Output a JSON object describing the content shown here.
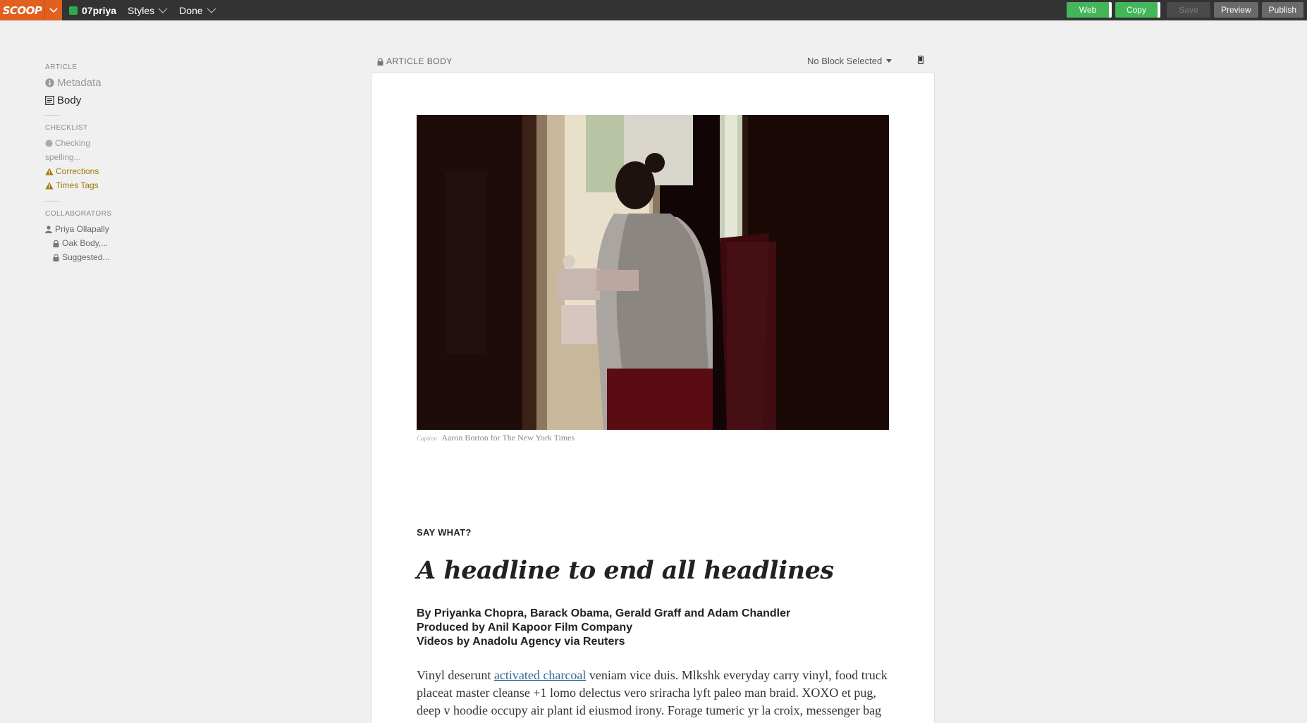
{
  "topbar": {
    "logo": "SCOOP",
    "user": "07priya",
    "menus": [
      "Styles",
      "Done"
    ],
    "buttons": {
      "web": "Web",
      "copy": "Copy",
      "save": "Save",
      "preview": "Preview",
      "publish": "Publish"
    },
    "colors": {
      "brand": "#e0601e",
      "green": "#43b65a",
      "bar": "#333333"
    }
  },
  "sidebar": {
    "article_title": "ARTICLE",
    "metadata": "Metadata",
    "body": "Body",
    "checklist_title": "CHECKLIST",
    "checking_1": "Checking",
    "checking_2": "spelling...",
    "corrections": "Corrections",
    "times_tags": "Times Tags",
    "collaborators_title": "COLLABORATORS",
    "collaborator": "Priya Ollapally",
    "lock_1": "Oak Body,...",
    "lock_2": "Suggested..."
  },
  "editor": {
    "label": "ARTICLE BODY",
    "block_selector": "No Block Selected"
  },
  "article": {
    "caption_tag": "Caption",
    "caption": "Aaron Borton for The New York Times",
    "kicker": "SAY WHAT?",
    "headline": "A headline to end all headlines",
    "byline_1": "By Priyanka Chopra, Barack Obama, Gerald Graff and Adam Chandler",
    "byline_2": "Produced by Anil Kapoor Film Company",
    "byline_3": "Videos by Anadolu Agency via Reuters",
    "body_before_link": "Vinyl deserunt ",
    "body_link": "activated charcoal",
    "body_after_link": " veniam vice duis. Mlkshk everyday carry vinyl, food truck placeat master cleanse +1 lomo delectus vero sriracha lyft paleo man braid. XOXO et pug, deep v hoodie occupy air plant id eiusmod irony. Forage tumeric yr la croix, messenger bag"
  }
}
